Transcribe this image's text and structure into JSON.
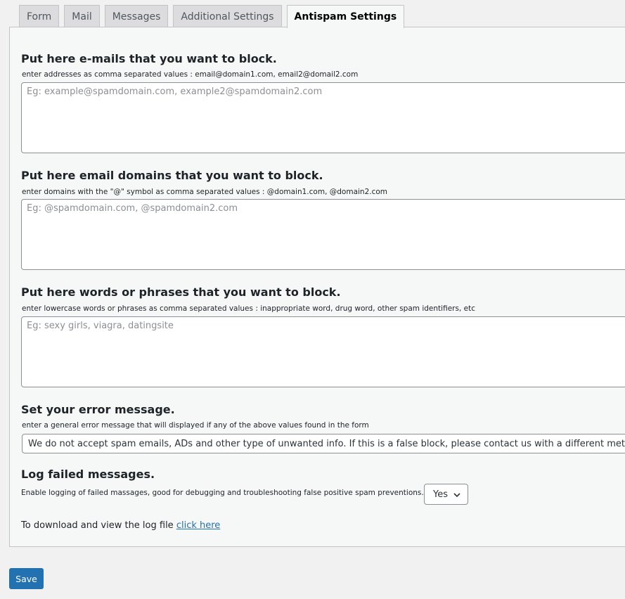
{
  "tabs": [
    {
      "label": "Form"
    },
    {
      "label": "Mail"
    },
    {
      "label": "Messages"
    },
    {
      "label": "Additional Settings"
    },
    {
      "label": "Antispam Settings",
      "active": true
    }
  ],
  "sections": {
    "emails": {
      "title": "Put here e-mails that you want to block.",
      "description": "enter addresses as comma separated values : email@domain1.com, email2@domail2.com",
      "placeholder": "Eg: example@spamdomain.com, example2@spamdomain2.com",
      "value": ""
    },
    "domains": {
      "title": "Put here email domains that you want to block.",
      "description": "enter domains with the \"@\" symbol as comma separated values : @domain1.com, @domain2.com",
      "placeholder": "Eg: @spamdomain.com, @spamdomain2.com",
      "value": ""
    },
    "words": {
      "title": "Put here words or phrases that you want to block.",
      "description": "enter lowercase words or phrases as comma separated values : inappropriate word, drug word, other spam identifiers, etc",
      "placeholder": "Eg: sexy girls, viagra, datingsite",
      "value": ""
    },
    "error_message": {
      "title": "Set your error message.",
      "description": "enter a general error message that will displayed if any of the above values found in the form",
      "value": "We do not accept spam emails, ADs and other type of unwanted info. If this is a false block, please contact us with a different method."
    },
    "log": {
      "title": "Log failed messages.",
      "description": "Enable logging of failed massages, good for debugging and troubleshooting false positive spam preventions.",
      "selected": "Yes",
      "download_text": "To download and view the log file",
      "link_text": "click here"
    }
  },
  "save_label": "Save",
  "icons": {
    "select_chevron": "chevron-down-icon"
  },
  "colors": {
    "primary": "#2271b1",
    "link": "#2271b1",
    "background": "#f1f1f1"
  }
}
